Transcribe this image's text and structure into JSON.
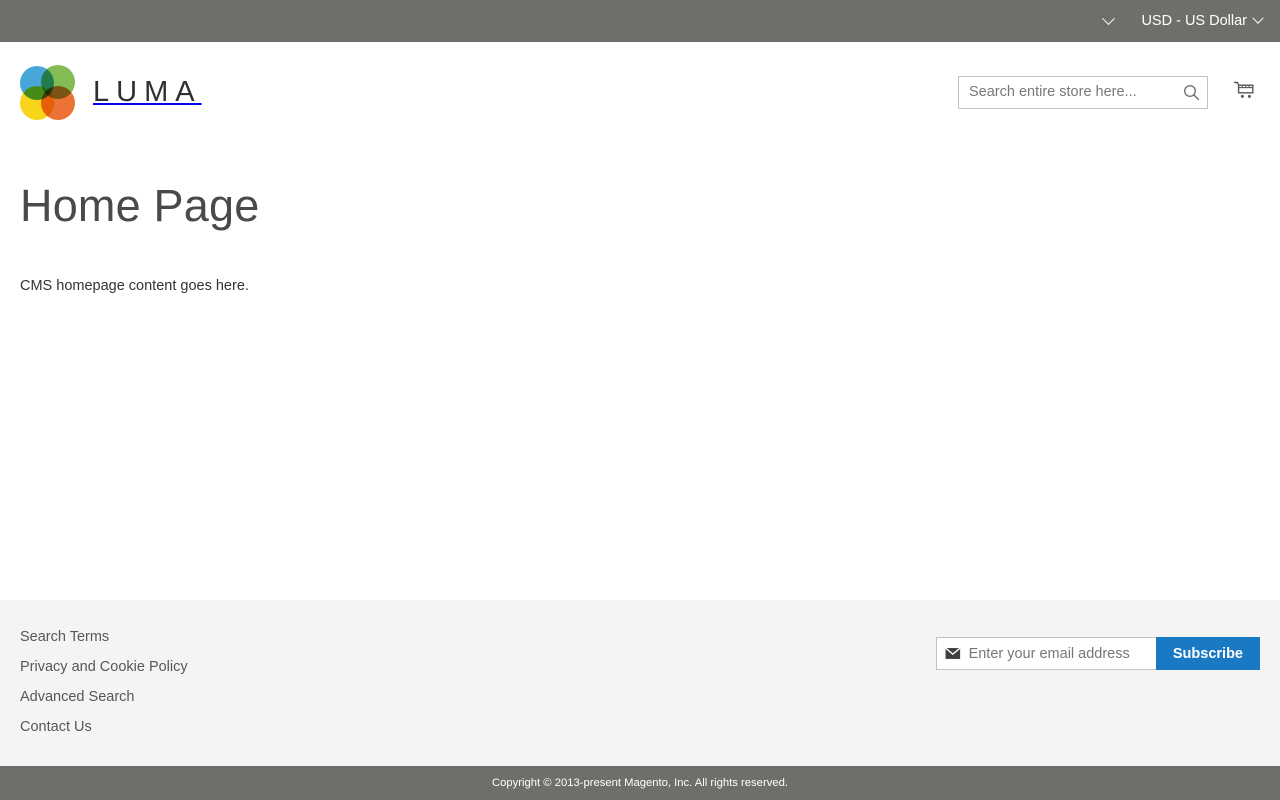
{
  "top_panel": {
    "account_menu_icon": "chevron-down-icon",
    "currency_switcher": {
      "label": "USD - US Dollar",
      "icon": "chevron-down-icon"
    }
  },
  "header": {
    "logo": {
      "text": "LUMA",
      "icon": "luma-logo-icon",
      "colors": {
        "blue": "#3aa0d6",
        "green": "#7ab648",
        "orange": "#ec6726",
        "yellow": "#f8d109"
      }
    },
    "search": {
      "placeholder": "Search entire store here...",
      "value": "",
      "button_icon": "search-icon"
    },
    "cart": {
      "icon": "shopping-cart-icon"
    }
  },
  "main": {
    "title": "Home Page",
    "body_text": "CMS homepage content goes here."
  },
  "footer": {
    "links": [
      {
        "label": "Search Terms"
      },
      {
        "label": "Privacy and Cookie Policy"
      },
      {
        "label": "Advanced Search"
      },
      {
        "label": "Contact Us"
      }
    ],
    "newsletter": {
      "icon": "envelope-icon",
      "placeholder": "Enter your email address",
      "value": "",
      "subscribe_label": "Subscribe",
      "accent_color": "#1979c3"
    }
  },
  "copyright": {
    "text": "Copyright © 2013-present Magento, Inc. All rights reserved.",
    "background": "#6e6f6b"
  }
}
